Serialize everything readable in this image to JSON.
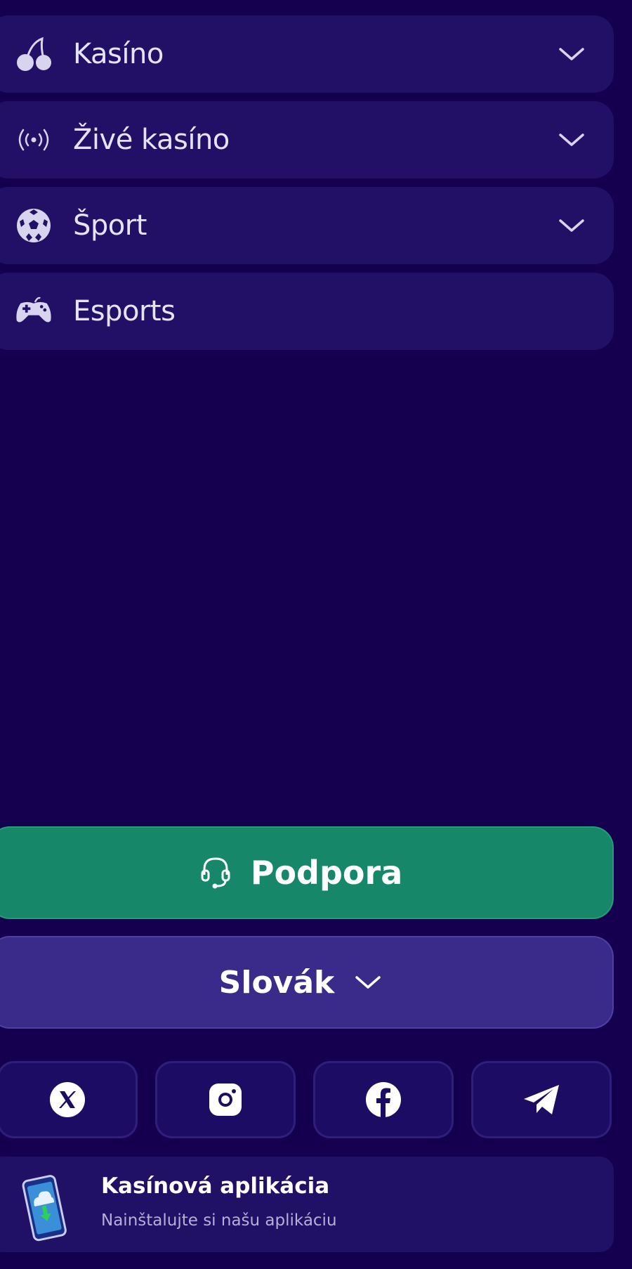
{
  "nav": {
    "items": [
      {
        "label": "Kasíno",
        "icon": "cherry-icon",
        "expandable": true
      },
      {
        "label": "Živé kasíno",
        "icon": "live-broadcast-icon",
        "expandable": true
      },
      {
        "label": "Šport",
        "icon": "soccer-ball-icon",
        "expandable": true
      },
      {
        "label": "Esports",
        "icon": "gamepad-icon",
        "expandable": false
      }
    ]
  },
  "support": {
    "label": "Podpora",
    "icon": "headset-icon"
  },
  "language": {
    "label": "Slovák",
    "icon": "chevron-down-icon"
  },
  "social": [
    {
      "name": "x-icon"
    },
    {
      "name": "instagram-icon"
    },
    {
      "name": "facebook-icon"
    },
    {
      "name": "telegram-icon"
    }
  ],
  "app_banner": {
    "title": "Kasínová aplikácia",
    "subtitle": "Nainštalujte si našu aplikáciu",
    "icon": "phone-download-icon"
  },
  "colors": {
    "background": "#14004f",
    "nav_item": "#211066",
    "support": "#17876a",
    "language": "#3a2b8a",
    "social": "#1d0c63"
  }
}
